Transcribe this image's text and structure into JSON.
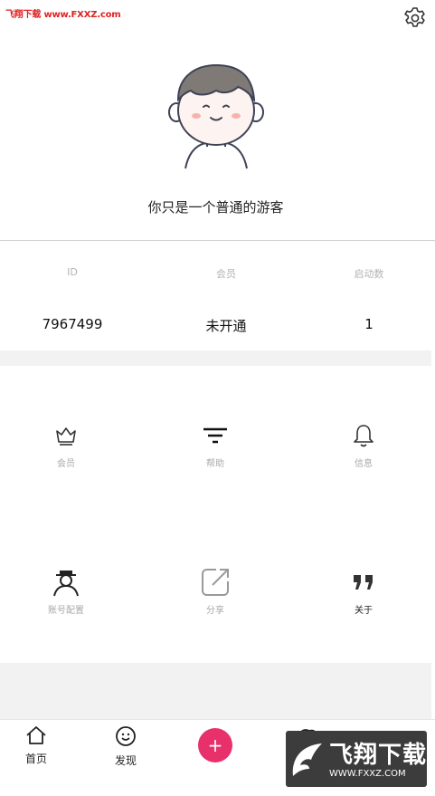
{
  "watermark": {
    "text": "飞翔下载 www.FXXZ.com"
  },
  "profile": {
    "nickname": "你只是一个普通的游客"
  },
  "stats": [
    {
      "label": "ID",
      "value": "7967499"
    },
    {
      "label": "会员",
      "value": "未开通"
    },
    {
      "label": "启动数",
      "value": "1"
    }
  ],
  "grid": [
    {
      "label": "会员",
      "icon": "crown-icon"
    },
    {
      "label": "帮助",
      "icon": "filter-icon"
    },
    {
      "label": "信息",
      "icon": "bell-icon"
    },
    {
      "label": "账号配置",
      "icon": "account-config-icon"
    },
    {
      "label": "分享",
      "icon": "share-icon"
    },
    {
      "label": "关于",
      "icon": "quote-icon"
    }
  ],
  "tabbar": [
    {
      "label": "首页",
      "icon": "home-icon"
    },
    {
      "label": "发现",
      "icon": "discover-icon"
    },
    {
      "label": "+",
      "icon": "add-icon"
    },
    {
      "label": "",
      "icon": "planet-icon"
    },
    {
      "label": "",
      "icon": "agent-icon"
    }
  ],
  "logo_watermark": {
    "title": "飞翔下载",
    "url": "WWW.FXXZ.COM"
  },
  "colors": {
    "accent": "#e8306b",
    "watermark_red": "#e02020",
    "section_gray": "#f2f2f2"
  }
}
